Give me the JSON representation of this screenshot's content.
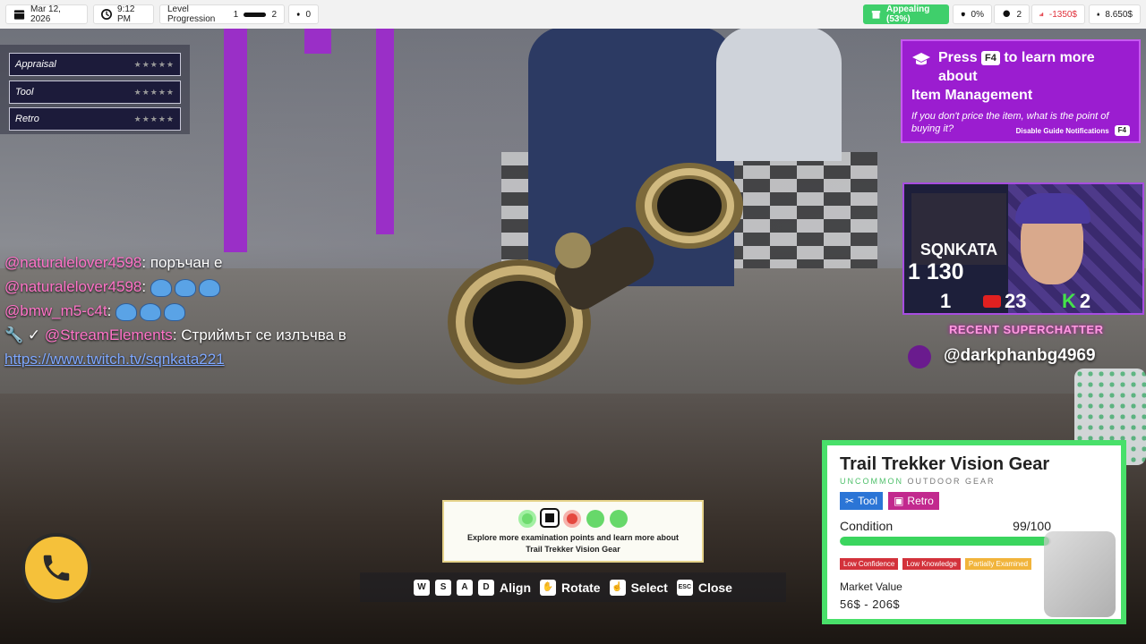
{
  "topbar": {
    "date": "Mar 12, 2026",
    "time": "9:12 PM",
    "level_label": "Level Progression",
    "level_from": "1",
    "level_to": "2",
    "notify_count": "0",
    "appeal": "Appealing (53%)",
    "stat_a": "0%",
    "stat_b": "2",
    "stat_c": "-1350$",
    "stat_d": "8.650$"
  },
  "traits": [
    {
      "label": "Appraisal",
      "stars": "★★★★★"
    },
    {
      "label": "Tool",
      "stars": "★★★★★"
    },
    {
      "label": "Retro",
      "stars": "★★★★★"
    }
  ],
  "chat": [
    {
      "user": "@naturalelover4598",
      "sep": ":",
      "text": " поръчан е"
    },
    {
      "user": "@naturalelover4598",
      "sep": ":",
      "text": ""
    },
    {
      "user": "@bmw_m5-c4t",
      "sep": ":",
      "text": ""
    },
    {
      "user": "@StreamElements",
      "sep": ":",
      "text": " Стриймът се излъчва в"
    }
  ],
  "chat_link": "https://www.twitch.tv/sqnkata221",
  "guide": {
    "press": "Press",
    "key": "F4",
    "line1_rest": "to learn more about",
    "line2": "Item Management",
    "sub": "If you don't price the item, what is the point of buying it?",
    "disable": "Disable Guide Notifications",
    "disable_key": "F4"
  },
  "cam": {
    "logo": "SQNKATA",
    "followers": "1 130",
    "stat1": "1",
    "yt": "23",
    "kick_letter": "K",
    "kick": "2"
  },
  "superchatter": {
    "title": "RECENT SUPERCHATTER",
    "name": "@darkphanbg4969"
  },
  "item": {
    "name": "Trail Trekker Vision Gear",
    "rarity": "UNCOMMON",
    "category": "OUTDOOR GEAR",
    "tag1": "Tool",
    "tag2": "Retro",
    "condition_label": "Condition",
    "condition_value": "99/100",
    "condition_fraction": 0.99,
    "badge1": "Low Confidence",
    "badge2": "Low Knowledge",
    "badge3": "Partially Examined",
    "market_label": "Market Value",
    "market_value": "56$ - 206$"
  },
  "explore": {
    "line1": "Explore more examination points and learn more about",
    "line2": "Trail Trekker Vision Gear"
  },
  "controls": {
    "k_w": "W",
    "k_s": "S",
    "k_a": "A",
    "k_d": "D",
    "align": "Align",
    "rotate": "Rotate",
    "select": "Select",
    "k_esc": "ESC",
    "close": "Close"
  }
}
